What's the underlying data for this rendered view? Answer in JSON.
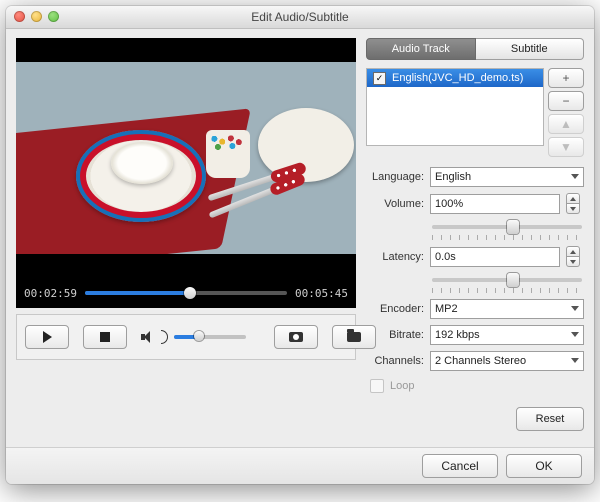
{
  "window": {
    "title": "Edit Audio/Subtitle"
  },
  "tabs": {
    "audio": "Audio Track",
    "subtitle": "Subtitle"
  },
  "tracks": {
    "items": [
      {
        "label": "English(JVC_HD_demo.ts)",
        "checked": true
      }
    ]
  },
  "player": {
    "current_time": "00:02:59",
    "duration": "00:05:45",
    "progress_pct": 52,
    "volume_pct": 35
  },
  "labels": {
    "language": "Language:",
    "volume": "Volume:",
    "latency": "Latency:",
    "encoder": "Encoder:",
    "bitrate": "Bitrate:",
    "channels": "Channels:",
    "loop": "Loop"
  },
  "values": {
    "language": "English",
    "volume": "100%",
    "latency": "0.0s",
    "encoder": "MP2",
    "bitrate": "192 kbps",
    "channels": "2 Channels Stereo"
  },
  "side_buttons": {
    "add": "+",
    "remove": "−",
    "up": "▲",
    "down": "▼"
  },
  "buttons": {
    "reset": "Reset",
    "cancel": "Cancel",
    "ok": "OK"
  },
  "colors": {
    "selection": "#2b7de0"
  }
}
